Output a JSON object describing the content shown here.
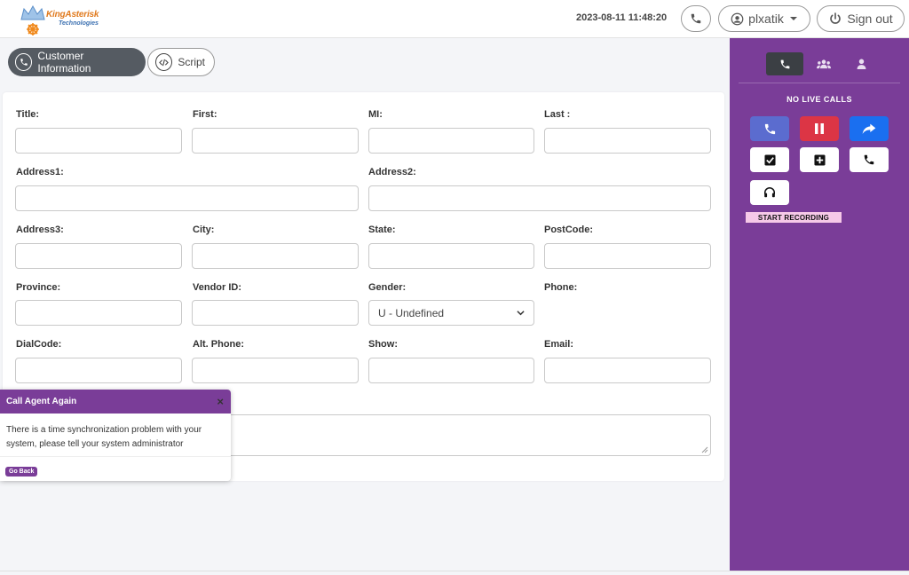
{
  "header": {
    "logo_text": "KingAsterisk",
    "logo_sub": "Technologies",
    "datetime": "2023-08-11 11:48:20",
    "username": "plxatik",
    "signout_label": "Sign out"
  },
  "tabs": [
    {
      "label": "Customer Information",
      "active": true
    },
    {
      "label": "Script",
      "active": false
    }
  ],
  "form": {
    "title_label": "Title:",
    "first_label": "First:",
    "mi_label": "MI:",
    "last_label": "Last :",
    "address1_label": "Address1:",
    "address2_label": "Address2:",
    "address3_label": "Address3:",
    "city_label": "City:",
    "state_label": "State:",
    "postcode_label": "PostCode:",
    "province_label": "Province:",
    "vendor_label": "Vendor ID:",
    "gender_label": "Gender:",
    "gender_value": "U - Undefined",
    "phone_label": "Phone:",
    "dialcode_label": "DialCode:",
    "altphone_label": "Alt. Phone:",
    "show_label": "Show:",
    "email_label": "Email:"
  },
  "right_panel": {
    "status_text": "NO LIVE CALLS",
    "record_label": "START RECORDING"
  },
  "toast": {
    "title": "Call Agent Again",
    "message": "There is a time synchronization problem with your system, please tell your system administrator",
    "button_label": "Go Back"
  },
  "colors": {
    "brand_purple": "#7a3d98",
    "blue_button": "#5b6ccf",
    "red_button": "#dc3545",
    "bright_blue_button": "#1a6ff0"
  }
}
